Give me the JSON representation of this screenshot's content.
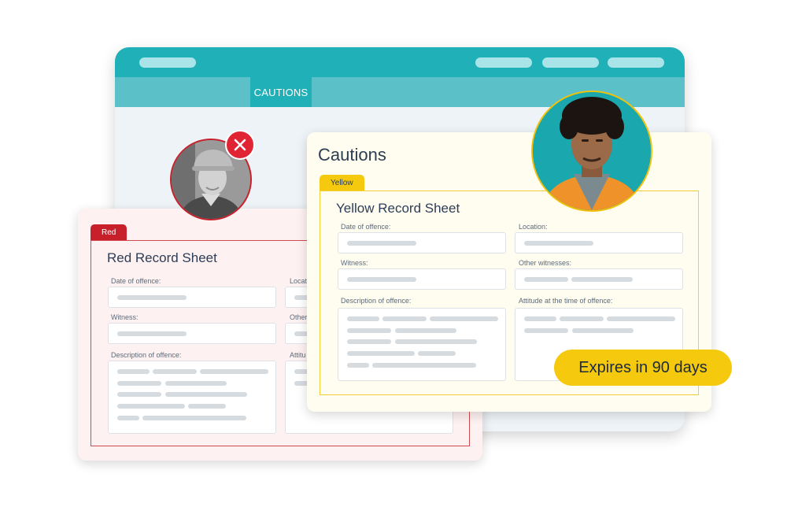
{
  "app": {
    "nav_tab": "CAUTIONS"
  },
  "red_card": {
    "tab": "Red",
    "title": "Red Record Sheet",
    "labels": {
      "date": "Date of offence:",
      "location": "Locat",
      "witness": "Witness:",
      "other": "Other",
      "description": "Description of offence:",
      "attitude": "Attitu"
    }
  },
  "yellow_card": {
    "heading": "Cautions",
    "tab": "Yellow",
    "title": "Yellow Record Sheet",
    "labels": {
      "date": "Date of offence:",
      "location": "Location:",
      "witness": "Witness:",
      "other_witnesses": "Other witnesses:",
      "description": "Description of offence:",
      "attitude": "Attitude at the time of offence:"
    }
  },
  "badge": {
    "expires": "Expires in 90 days"
  },
  "icons": {
    "close": "close-icon",
    "red_avatar": "worker-avatar",
    "yellow_avatar": "employee-avatar"
  },
  "colors": {
    "teal": "#1fb0b8",
    "teal_light": "#5bc0c7",
    "red": "#c8202b",
    "yellow": "#f5c90e"
  }
}
